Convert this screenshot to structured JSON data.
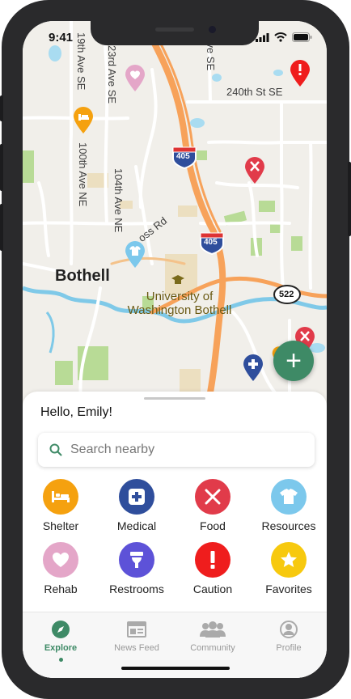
{
  "status": {
    "time": "9:41"
  },
  "map": {
    "labels": {
      "ave_19th": "19th Ave SE",
      "ave_23rd": "23rd Ave SE",
      "ave_top": "Ave SE",
      "st_240th": "240th St SE",
      "ave_100th": "100th Ave NE",
      "ave_104th": "104th Ave NE",
      "ross_rd": "oss Rd",
      "city": "Bothell",
      "university_line1": "University of",
      "university_line2": "Washington Bothell"
    },
    "shields": {
      "i405_a": "405",
      "i405_b": "405",
      "sr522": "522"
    }
  },
  "fab": {
    "label": "+"
  },
  "sheet": {
    "greeting": "Hello, Emily!",
    "search": {
      "placeholder": "Search nearby",
      "value": ""
    },
    "categories": [
      {
        "label": "Shelter",
        "icon": "bed-icon",
        "color": "#f5a10f"
      },
      {
        "label": "Medical",
        "icon": "medical-cross-icon",
        "color": "#2f4e9c"
      },
      {
        "label": "Food",
        "icon": "fork-knife-icon",
        "color": "#e13b4a"
      },
      {
        "label": "Resources",
        "icon": "tshirt-icon",
        "color": "#7cc8ec"
      },
      {
        "label": "Rehab",
        "icon": "heart-icon",
        "color": "#e4a6c8"
      },
      {
        "label": "Restrooms",
        "icon": "toilet-icon",
        "color": "#5d52d8"
      },
      {
        "label": "Caution",
        "icon": "exclamation-icon",
        "color": "#ef1d1d"
      },
      {
        "label": "Favorites",
        "icon": "star-icon",
        "color": "#f7c90e"
      }
    ]
  },
  "tabs": [
    {
      "label": "Explore",
      "icon": "compass-icon",
      "active": true
    },
    {
      "label": "News Feed",
      "icon": "newspaper-icon",
      "active": false
    },
    {
      "label": "Community",
      "icon": "people-icon",
      "active": false
    },
    {
      "label": "Profile",
      "icon": "user-icon",
      "active": false
    }
  ],
  "colors": {
    "accent": "#3e8a66",
    "highway": "#f7a25a",
    "water": "#7fc9e8",
    "park": "#b8db96"
  }
}
